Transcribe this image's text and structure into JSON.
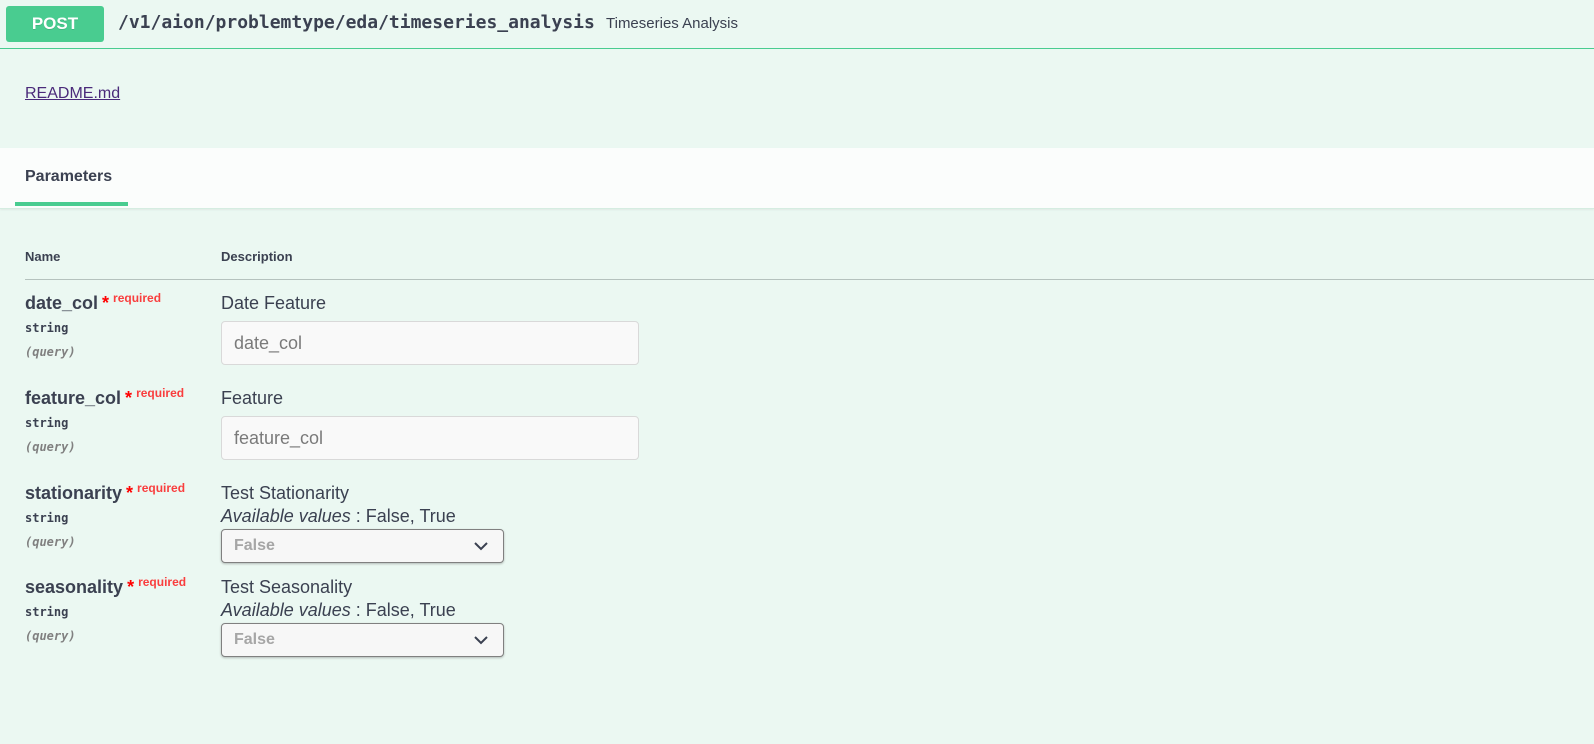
{
  "summary": {
    "method": "POST",
    "path": "/v1/aion/problemtype/eda/timeseries_analysis",
    "description": "Timeseries Analysis"
  },
  "readme_link": "README.md",
  "tabs": [
    {
      "label": "Parameters",
      "active": true
    }
  ],
  "columns": {
    "name": "Name",
    "description": "Description"
  },
  "required_label": "required",
  "required_star": "*",
  "available_values_label": "Available values",
  "params": [
    {
      "name": "date_col",
      "type": "string",
      "in": "(query)",
      "description": "Date Feature",
      "input_placeholder": "date_col"
    },
    {
      "name": "feature_col",
      "type": "string",
      "in": "(query)",
      "description": "Feature",
      "input_placeholder": "feature_col"
    },
    {
      "name": "stationarity",
      "type": "string",
      "in": "(query)",
      "description": "Test Stationarity",
      "available_values": ": False, True",
      "selected": "False"
    },
    {
      "name": "seasonality",
      "type": "string",
      "in": "(query)",
      "description": "Test Seasonality",
      "available_values": ": False, True",
      "selected": "False"
    }
  ],
  "colors": {
    "post_green": "#49cc90",
    "background": "#ebf8f2",
    "required_red": "#f93e3e"
  },
  "icons": {
    "select_arrow": "chevron-down-icon"
  }
}
